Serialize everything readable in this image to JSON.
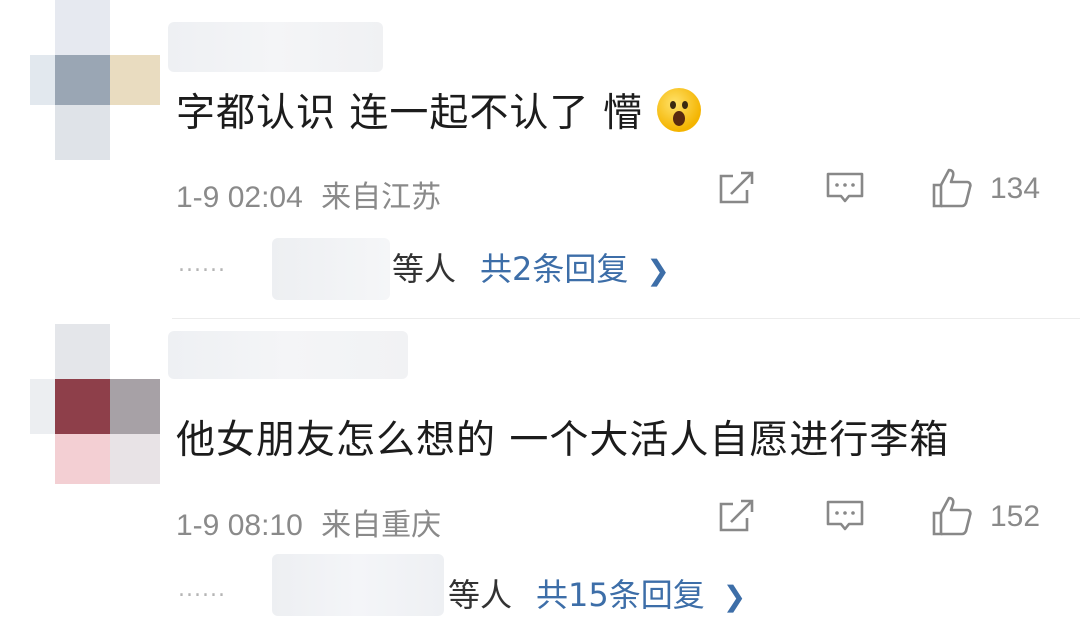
{
  "comments": [
    {
      "text": "字都认识  连一起不认了   懵",
      "emoji": "astonished-face",
      "time": "1-9 02:04",
      "location": "来自江苏",
      "likes": "134",
      "replies_prefix": "......",
      "replies_who": "等人",
      "replies_more": "共2条回复"
    },
    {
      "text": "他女朋友怎么想的 一个大活人自愿进行李箱",
      "time": "1-9 08:10",
      "location": "来自重庆",
      "likes": "152",
      "replies_prefix": "......",
      "replies_who": "等人",
      "replies_more": "共15条回复"
    }
  ],
  "colors": {
    "text": "#1c1c1c",
    "meta": "#8a8a8a",
    "link": "#3d6ea8"
  },
  "icons": [
    "share-icon",
    "comment-icon",
    "like-icon",
    "chevron-right-icon",
    "astonished-emoji-icon"
  ]
}
